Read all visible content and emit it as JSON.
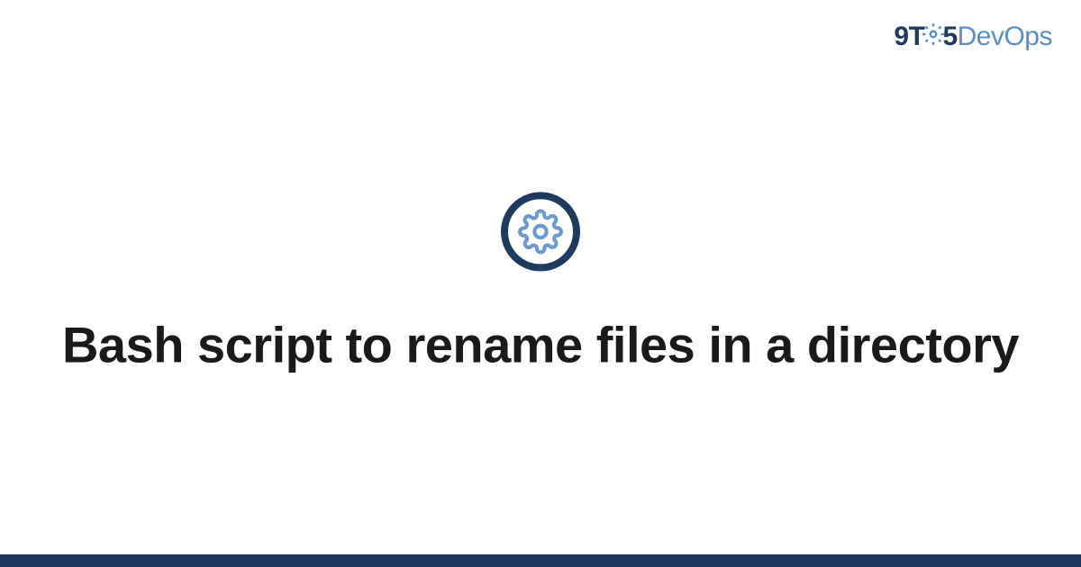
{
  "logo": {
    "part1": "9T",
    "part2": "5",
    "part3": "DevOps"
  },
  "title": "Bash script to rename files in a directory",
  "icon_name": "gear-icon",
  "colors": {
    "primary": "#1e3a5f",
    "accent": "#5a8fc4"
  }
}
